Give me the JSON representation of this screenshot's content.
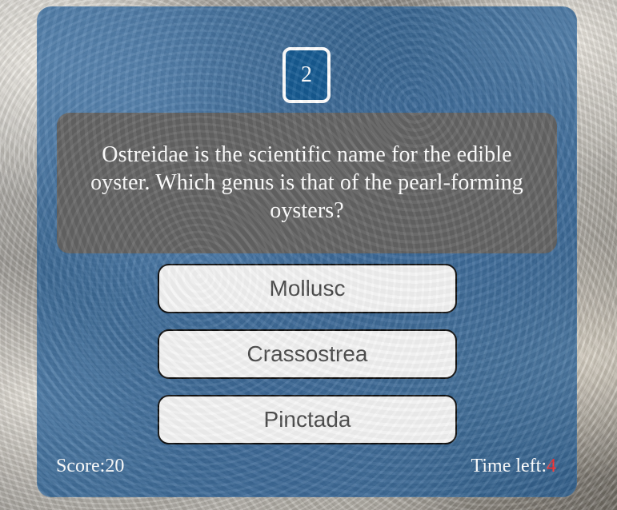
{
  "quiz": {
    "question_number": "2",
    "question_text": "Ostreidae is the scientific name for the edible oyster. Which genus is that of the pearl-forming oysters?",
    "answers": [
      {
        "label": "Mollusc"
      },
      {
        "label": "Crassostrea"
      },
      {
        "label": "Pinctada"
      }
    ]
  },
  "footer": {
    "score_label": "Score:",
    "score_value": "20",
    "time_label": "Time left:",
    "time_value": "4"
  },
  "colors": {
    "panel": "#1d5a95",
    "question_box": "#646464",
    "timer_value": "#ff2f2f",
    "button_background": "#f4f4f4"
  }
}
